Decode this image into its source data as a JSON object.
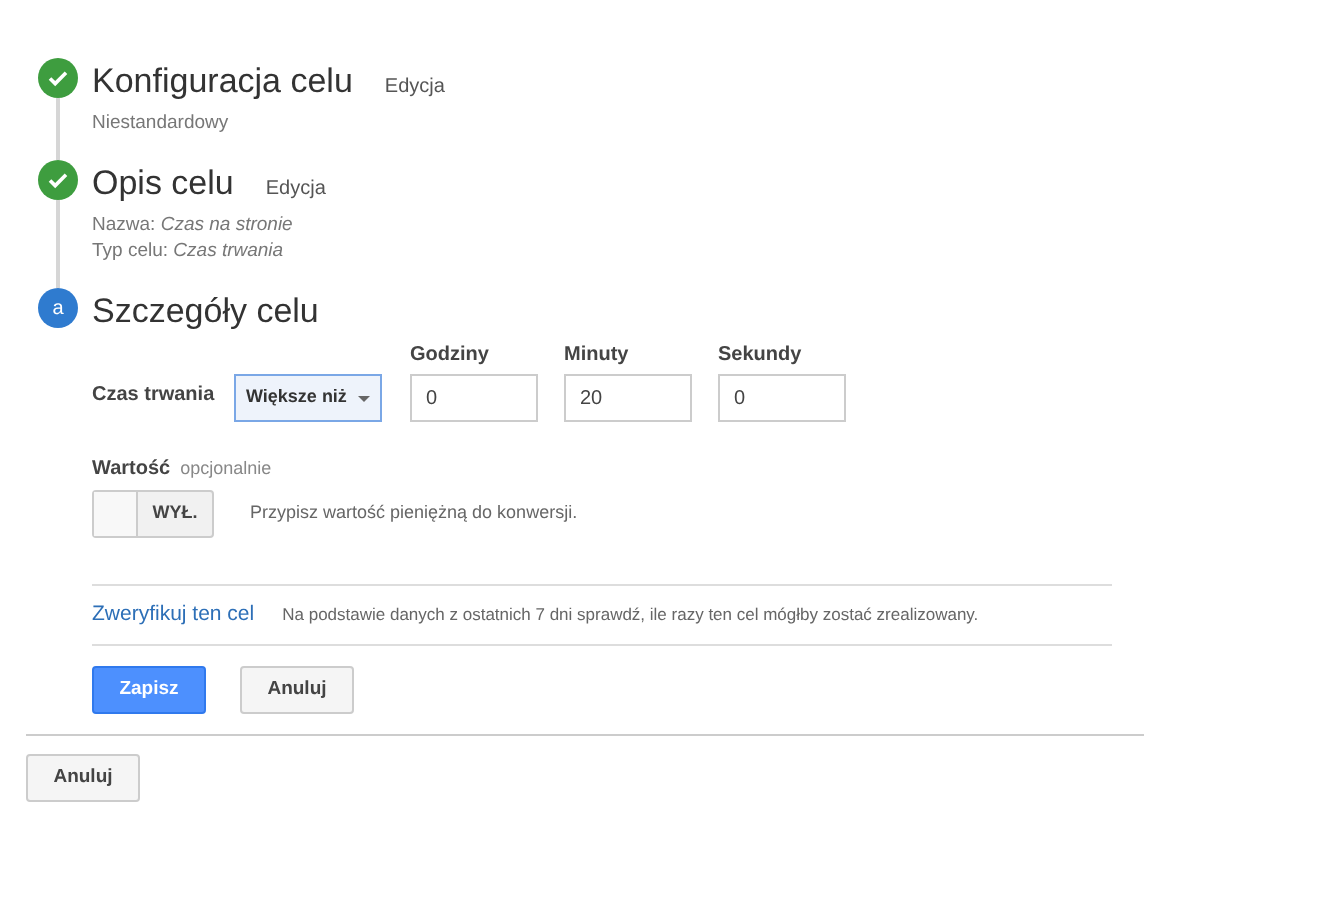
{
  "steps": [
    {
      "kind": "done",
      "title": "Konfiguracja celu",
      "edit_link": "Edycja",
      "details": [
        "Niestandardowy"
      ]
    },
    {
      "kind": "done",
      "title": "Opis celu",
      "edit_link": "Edycja",
      "details": [
        "Nazwa: *Czas na stronie*",
        "Typ celu: *Czas trwania*"
      ]
    },
    {
      "kind": "current",
      "badge": "a",
      "title": "Szczegóły celu"
    }
  ],
  "duration": {
    "label": "Czas trwania",
    "comparison": "Większe niż",
    "fields": [
      {
        "label": "Godziny",
        "value": "0"
      },
      {
        "label": "Minuty",
        "value": "20"
      },
      {
        "label": "Sekundy",
        "value": "0"
      }
    ]
  },
  "value": {
    "label": "Wartość",
    "hint": "opcjonalnie",
    "toggle": {
      "on": false,
      "text": "WYŁ."
    },
    "description": "Przypisz wartość pieniężną do konwersji."
  },
  "verify": {
    "link": "Zweryfikuj ten cel",
    "text": "Na podstawie danych z ostatnich 7 dni sprawdź, ile razy ten cel mógłby zostać zrealizowany."
  },
  "form_buttons": [
    {
      "kind": "primary",
      "label": "Zapisz"
    },
    {
      "kind": "secondary",
      "label": "Anuluj"
    }
  ],
  "footer_button": "Anuluj"
}
